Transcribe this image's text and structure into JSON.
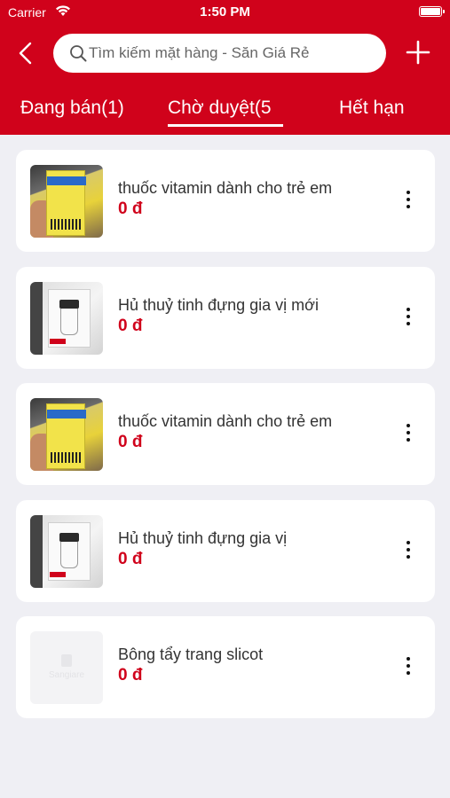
{
  "status_bar": {
    "carrier": "Carrier",
    "time": "1:50 PM"
  },
  "header": {
    "background_color": "#d0021b",
    "back_icon": "chevron-left-icon",
    "add_icon": "plus-icon",
    "search": {
      "placeholder": "Tìm kiếm mặt hàng - Săn Giá Rẻ",
      "value": ""
    }
  },
  "tabs": [
    {
      "label": "Đang bán(1)",
      "active": false
    },
    {
      "label": "Chờ duyệt(5",
      "active": true
    },
    {
      "label": "Hết hạn",
      "active": false
    }
  ],
  "products": [
    {
      "name": "thuốc vitamin dành cho trẻ em",
      "price": "0 đ",
      "image": "vitamin-photo"
    },
    {
      "name": "Hủ thuỷ tinh đựng gia vị mới",
      "price": "0 đ",
      "image": "glass-jar-photo"
    },
    {
      "name": "thuốc vitamin dành cho trẻ em",
      "price": "0 đ",
      "image": "vitamin-photo"
    },
    {
      "name": "Hủ thuỷ tinh đựng gia vị",
      "price": "0 đ",
      "image": "glass-jar-photo"
    },
    {
      "name": "Bông tẩy trang slicot",
      "price": "0 đ",
      "image": "placeholder-image",
      "placeholder_text": "Sangiare"
    }
  ],
  "price_color": "#d0021b"
}
